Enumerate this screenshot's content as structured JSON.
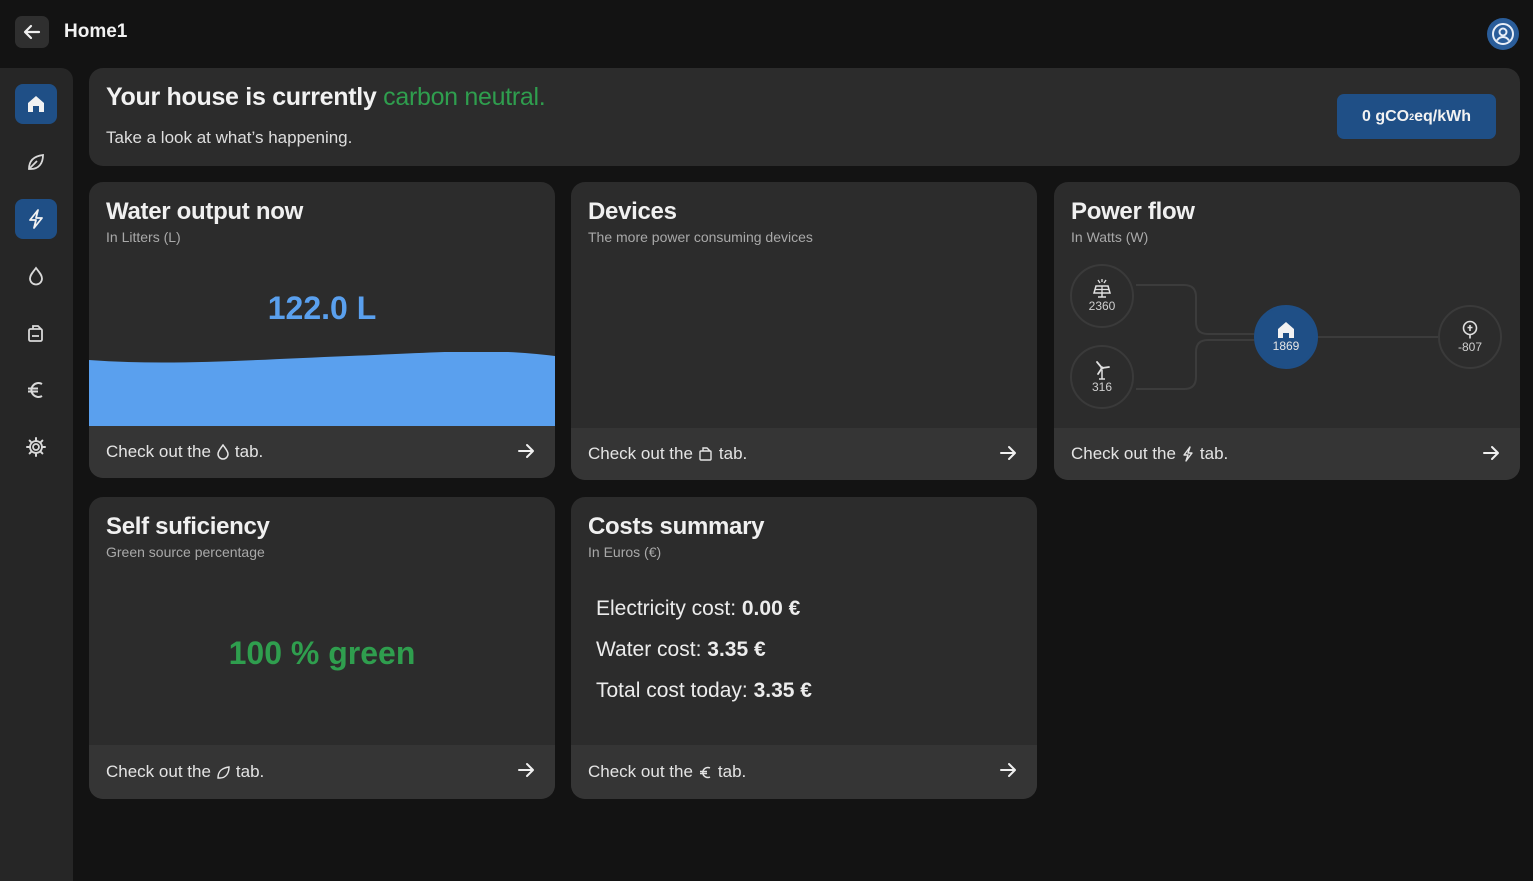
{
  "header": {
    "title": "Home1"
  },
  "banner": {
    "title_prefix": "Your house is currently ",
    "title_accent": "carbon neutral.",
    "subtitle": "Take a look at what’s happening.",
    "carbon_main": "0 gCO",
    "carbon_sub": "2",
    "carbon_unit": "eq/kWh"
  },
  "footer_common": {
    "prefix": "Check out the",
    "suffix": "tab."
  },
  "water": {
    "title": "Water output now",
    "subtitle": "In Litters (L)",
    "value": "122.0 L"
  },
  "devices": {
    "title": "Devices",
    "subtitle": "The more power consuming devices"
  },
  "power_flow": {
    "title": "Power flow",
    "subtitle": "In Watts (W)",
    "solar": "2360",
    "wind": "316",
    "home": "1869",
    "grid": "-807"
  },
  "self_sufficiency": {
    "title": "Self suficiency",
    "subtitle": "Green source percentage",
    "value": "100 % green"
  },
  "costs": {
    "title": "Costs summary",
    "subtitle": "In Euros (€)",
    "electricity_label": "Electricity cost:",
    "electricity_value": "0.00 €",
    "water_label": "Water cost:",
    "water_value": "3.35 €",
    "total_label": "Total cost today:",
    "total_value": "3.35 €"
  },
  "colors": {
    "accent_blue": "#1f4f86",
    "accent_green": "#2f9e4e",
    "water_blue": "#5aa0ee"
  }
}
